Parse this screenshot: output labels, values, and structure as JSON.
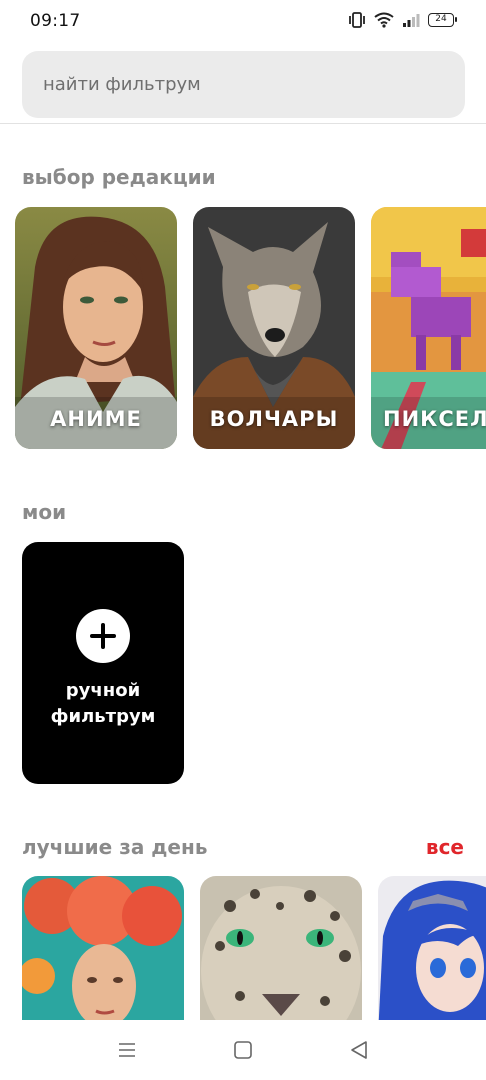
{
  "status_bar": {
    "time": "09:17",
    "battery": "24",
    "icons": [
      "vibrate-icon",
      "wifi-icon",
      "signal-icon",
      "battery-icon"
    ]
  },
  "search": {
    "placeholder": "найти фильтрум"
  },
  "editors_choice": {
    "title": "выбор редакции",
    "cards": [
      {
        "label": "АНИМЕ",
        "image": "anime-woman-portrait"
      },
      {
        "label": "ВОЛЧАРЫ",
        "image": "wolf-in-jacket-portrait"
      },
      {
        "label": "ПИКСЕЛ",
        "image": "pixel-art-pony"
      }
    ]
  },
  "mine": {
    "title": "мои",
    "manual_card": {
      "line1": "ручной",
      "line2": "фильтрум",
      "icon": "plus-icon"
    }
  },
  "best_of_day": {
    "title": "лучшие за день",
    "see_all": "все",
    "cards": [
      {
        "image": "coral-girl-portrait"
      },
      {
        "image": "snow-leopard-portrait"
      },
      {
        "image": "anime-blue-hair-girl"
      }
    ]
  },
  "nav": {
    "icons": [
      "menu-icon",
      "home-icon",
      "back-icon"
    ]
  },
  "colors": {
    "accent": "#e0262b",
    "section_title": "#8a8a8a",
    "search_bg": "#ebebeb"
  }
}
